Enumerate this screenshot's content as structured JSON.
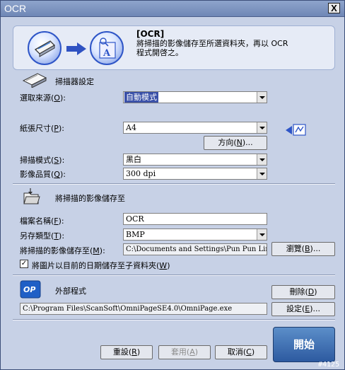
{
  "window": {
    "title": "OCR"
  },
  "banner": {
    "title": "[OCR]",
    "desc_line1": "將掃描的影像儲存至所選資料夾，再以 OCR",
    "desc_line2": "程式開啓之。"
  },
  "scanner": {
    "section_title": "掃描器設定",
    "source_label": "選取來源(",
    "source_key": "O",
    "source_value": "自動模式",
    "paper_label": "紙張尺寸(",
    "paper_key": "P",
    "paper_value": "A4",
    "orientation_btn": "方向(",
    "orientation_key": "N",
    "orientation_tail": ")...",
    "mode_label": "掃描模式(",
    "mode_key": "S",
    "mode_value": "黑白",
    "quality_label": "影像品質(",
    "quality_key": "Q",
    "quality_value": "300 dpi"
  },
  "save": {
    "section_title": "將掃描的影像儲存至",
    "filename_label": "檔案名稱(",
    "filename_key": "F",
    "filename_value": "OCR",
    "type_label": "另存類型(",
    "type_key": "T",
    "type_value": "BMP",
    "path_label": "將掃描的影像儲存至(",
    "path_key": "M",
    "path_value": "C:\\Documents and Settings\\Pun Pun Lin\\M",
    "browse_btn": "瀏覽(",
    "browse_key": "B",
    "browse_tail": ")...",
    "subfolder_label": "將圖片以目前的日期儲存至子資料夾(",
    "subfolder_key": "W",
    "subfolder_checked": "✓"
  },
  "external": {
    "section_title": "外部程式",
    "program_path": "C:\\Program Files\\ScanSoft\\OmniPageSE4.0\\OmniPage.exe",
    "delete_btn": "刪除(",
    "delete_key": "D",
    "settings_btn": "設定(",
    "settings_key": "E",
    "settings_tail": ")..."
  },
  "footer": {
    "reset_btn": "重設(",
    "reset_key": "R",
    "apply_btn": "套用(",
    "apply_key": "A",
    "cancel_btn": "取消(",
    "cancel_key": "C",
    "start_btn": "開始"
  },
  "watermark": "#4125",
  "close_glyph": "X"
}
